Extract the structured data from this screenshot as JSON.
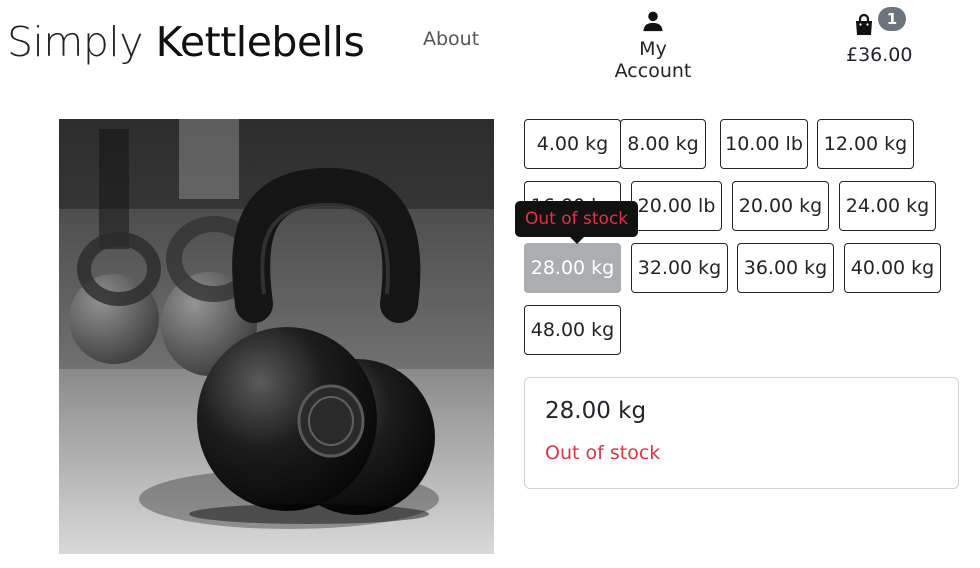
{
  "header": {
    "brand_light": "Simply ",
    "brand_bold": "Kettlebells",
    "about_label": "About",
    "account_label": "My Account",
    "account_icon": "user-icon",
    "cart_icon": "shopping-bag-icon",
    "cart_count": "1",
    "cart_total": "£36.00"
  },
  "product": {
    "image_alt": "Kettlebell"
  },
  "sizes": [
    {
      "label": "4.00 kg"
    },
    {
      "label": "8.00 kg"
    },
    {
      "label": "10.00 lb"
    },
    {
      "label": "12.00 kg"
    },
    {
      "label": "16.00 kg"
    },
    {
      "label": "20.00 lb"
    },
    {
      "label": "20.00 kg"
    },
    {
      "label": "24.00 kg"
    },
    {
      "label": "28.00 kg",
      "selected": true,
      "out_of_stock": true
    },
    {
      "label": "32.00 kg"
    },
    {
      "label": "36.00 kg"
    },
    {
      "label": "40.00 kg"
    },
    {
      "label": "48.00 kg"
    }
  ],
  "tooltip": "Out of stock",
  "selection": {
    "weight": "28.00 kg",
    "stock_status": "Out of stock"
  },
  "colors": {
    "out_of_stock": "#dc3545",
    "badge": "#6c757d",
    "disabled_button": "#aaaeb1"
  }
}
